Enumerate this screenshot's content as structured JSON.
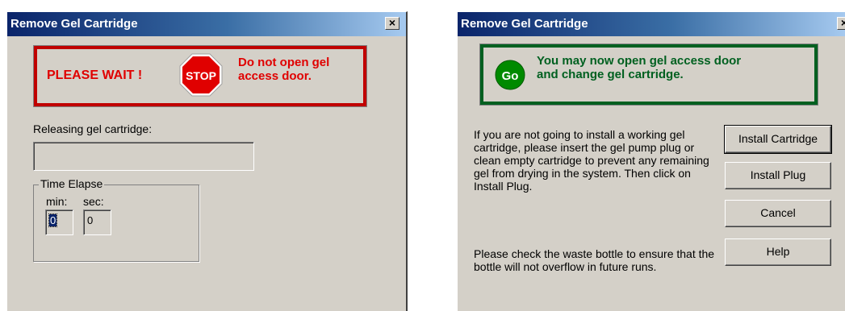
{
  "dialog_wait": {
    "title": "Remove Gel Cartridge",
    "close_glyph": "×",
    "wait_text": "PLEASE WAIT !",
    "stop_sign_text": "STOP",
    "warning_line1": "Do not open gel",
    "warning_line2": "access door.",
    "progress_label": "Releasing gel cartridge:",
    "progress_value": 0,
    "timer_group_label": "Time Elapse",
    "min_label": "min:",
    "sec_label": "sec:",
    "min_value": "0",
    "sec_value": "0"
  },
  "dialog_go": {
    "title": "Remove Gel Cartridge",
    "close_glyph": "×",
    "go_icon_text": "Go",
    "message_line1": "You may now open gel access door",
    "message_line2": "and change gel cartridge.",
    "instruction_paragraph": "If you are not going to install a working gel cartridge, please insert the gel pump plug or clean empty cartridge to prevent any remaining gel from drying in the system. Then click on Install Plug.",
    "waste_paragraph": "Please check the waste bottle to ensure that the bottle will not overflow in future runs.",
    "buttons": {
      "install_cartridge": "Install Cartridge",
      "install_plug": "Install Plug",
      "cancel": "Cancel",
      "help": "Help"
    }
  },
  "colors": {
    "warning_red": "#e00000",
    "go_green": "#006020",
    "window_face": "#d4d0c8",
    "titlebar_start": "#0a246a"
  },
  "icons": [
    "stop-sign-icon",
    "go-icon",
    "close-icon"
  ]
}
